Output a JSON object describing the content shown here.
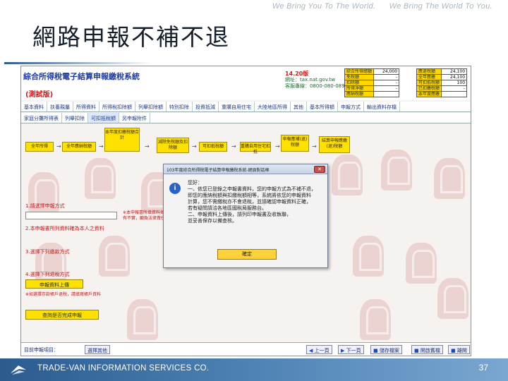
{
  "header": {
    "tagline_1": "We Bring You To The World.",
    "tagline_2": "We Bring The World To You."
  },
  "slide": {
    "title": "網路申報不補不退",
    "page_number": "37"
  },
  "footer": {
    "company": "TRADE-VAN INFORMATION SERVICES CO."
  },
  "app": {
    "title": "綜合所得稅電子結算申報繳稅系統",
    "badge": "(測試版)",
    "version": "14.20版",
    "info_lines": [
      "網址：tax.nat.gov.tw",
      "客服專線：0800-080-089"
    ],
    "summary_left": [
      {
        "label": "綜合所得總額",
        "value": "24,000"
      },
      {
        "label": "免稅額",
        "value": "-"
      },
      {
        "label": "扣除額",
        "value": "-"
      },
      {
        "label": "所得淨額",
        "value": "-"
      },
      {
        "label": "應納稅額",
        "value": ""
      }
    ],
    "summary_right": [
      {
        "label": "應退稅額",
        "value": "24,100"
      },
      {
        "label": "全年應繳",
        "value": "24,100"
      },
      {
        "label": "可扣抵稅額",
        "value": "100"
      },
      {
        "label": "已扣繳稅額",
        "value": "-"
      },
      {
        "label": "本年度應繳",
        "value": ""
      }
    ],
    "tabs_row1": [
      "基本資料",
      "扶養親屬",
      "所得資料",
      "所得稅扣除額",
      "列舉扣除額",
      "特別扣除",
      "投資抵減",
      "重購自用住宅",
      "大陸地區所得",
      "其他",
      "基本所得額",
      "申報方式",
      "輸出資料存檔"
    ],
    "tabs_row2": [
      "家庭分攤所得表",
      "列舉扣除",
      "可扣抵稅額",
      "另申報附件"
    ],
    "steps": [
      {
        "label": "全年所得"
      },
      {
        "label": "全年應納稅額"
      },
      {
        "label": "本年度扣繳稅額合計"
      },
      {
        "label": "減除免稅額及扣除額"
      },
      {
        "label": "可扣抵稅額"
      },
      {
        "label": "重購自用住宅扣抵"
      },
      {
        "label": "申報應補(退)稅額"
      },
      {
        "label": "結算申報應繳(退)稅額"
      }
    ],
    "form_labels": [
      "1.請選擇申報方式",
      "2.本申報書所列資料確為本人之資料",
      "3.選擇下列繳款方式",
      "4.選擇下列退稅方式"
    ],
    "form_notes": [
      "※本申報書所填資料如有不實，願負法律責任",
      "※如選擇存款帳戶退稅，請填寫帳戶資料"
    ],
    "form_buttons": [
      "申報資料上傳",
      "查詢是否完成申報"
    ],
    "bottom_label": "目前申報項目：",
    "bottom_field": "選擇其他",
    "bottom_buttons": [
      "上一頁",
      "下一頁",
      "儲存檔案",
      "開啟舊檔",
      "離開"
    ]
  },
  "dialog": {
    "title": "103年度綜合所得稅電子結算申報繳稅系統-網頁對話框",
    "heading": "您好：",
    "body": [
      "一、依您已登錄之申報書資料，您的申報方式為不補不退，",
      "即您的應納稅額與扣繳稅額相等，系統將依您的申報資料",
      "計算，您不需繳稅亦不會退稅，並請確認申報資料正確，",
      "若有疑問請洽各地區國稅局服務台。",
      "二、申報資料上傳後，請列印申報書及收執聯，",
      "並妥善保存以備查核。"
    ],
    "ok_label": "確定"
  }
}
